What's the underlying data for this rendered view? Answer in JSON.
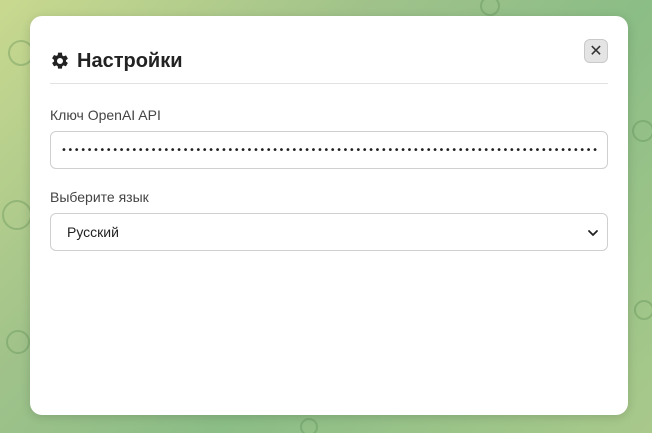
{
  "modal": {
    "title": "Настройки",
    "close_symbol": "✕"
  },
  "icons": {
    "title": "gear-icon",
    "close": "close-icon",
    "select": "chevron-down-icon"
  },
  "api_key": {
    "label": "Ключ OpenAI API",
    "value": "••••••••••••••••••••••••••••••••••••••••••••••••••••••••••••••••••••••••••••••••••••••••"
  },
  "language": {
    "label": "Выберите язык",
    "selected": "Русский"
  }
}
